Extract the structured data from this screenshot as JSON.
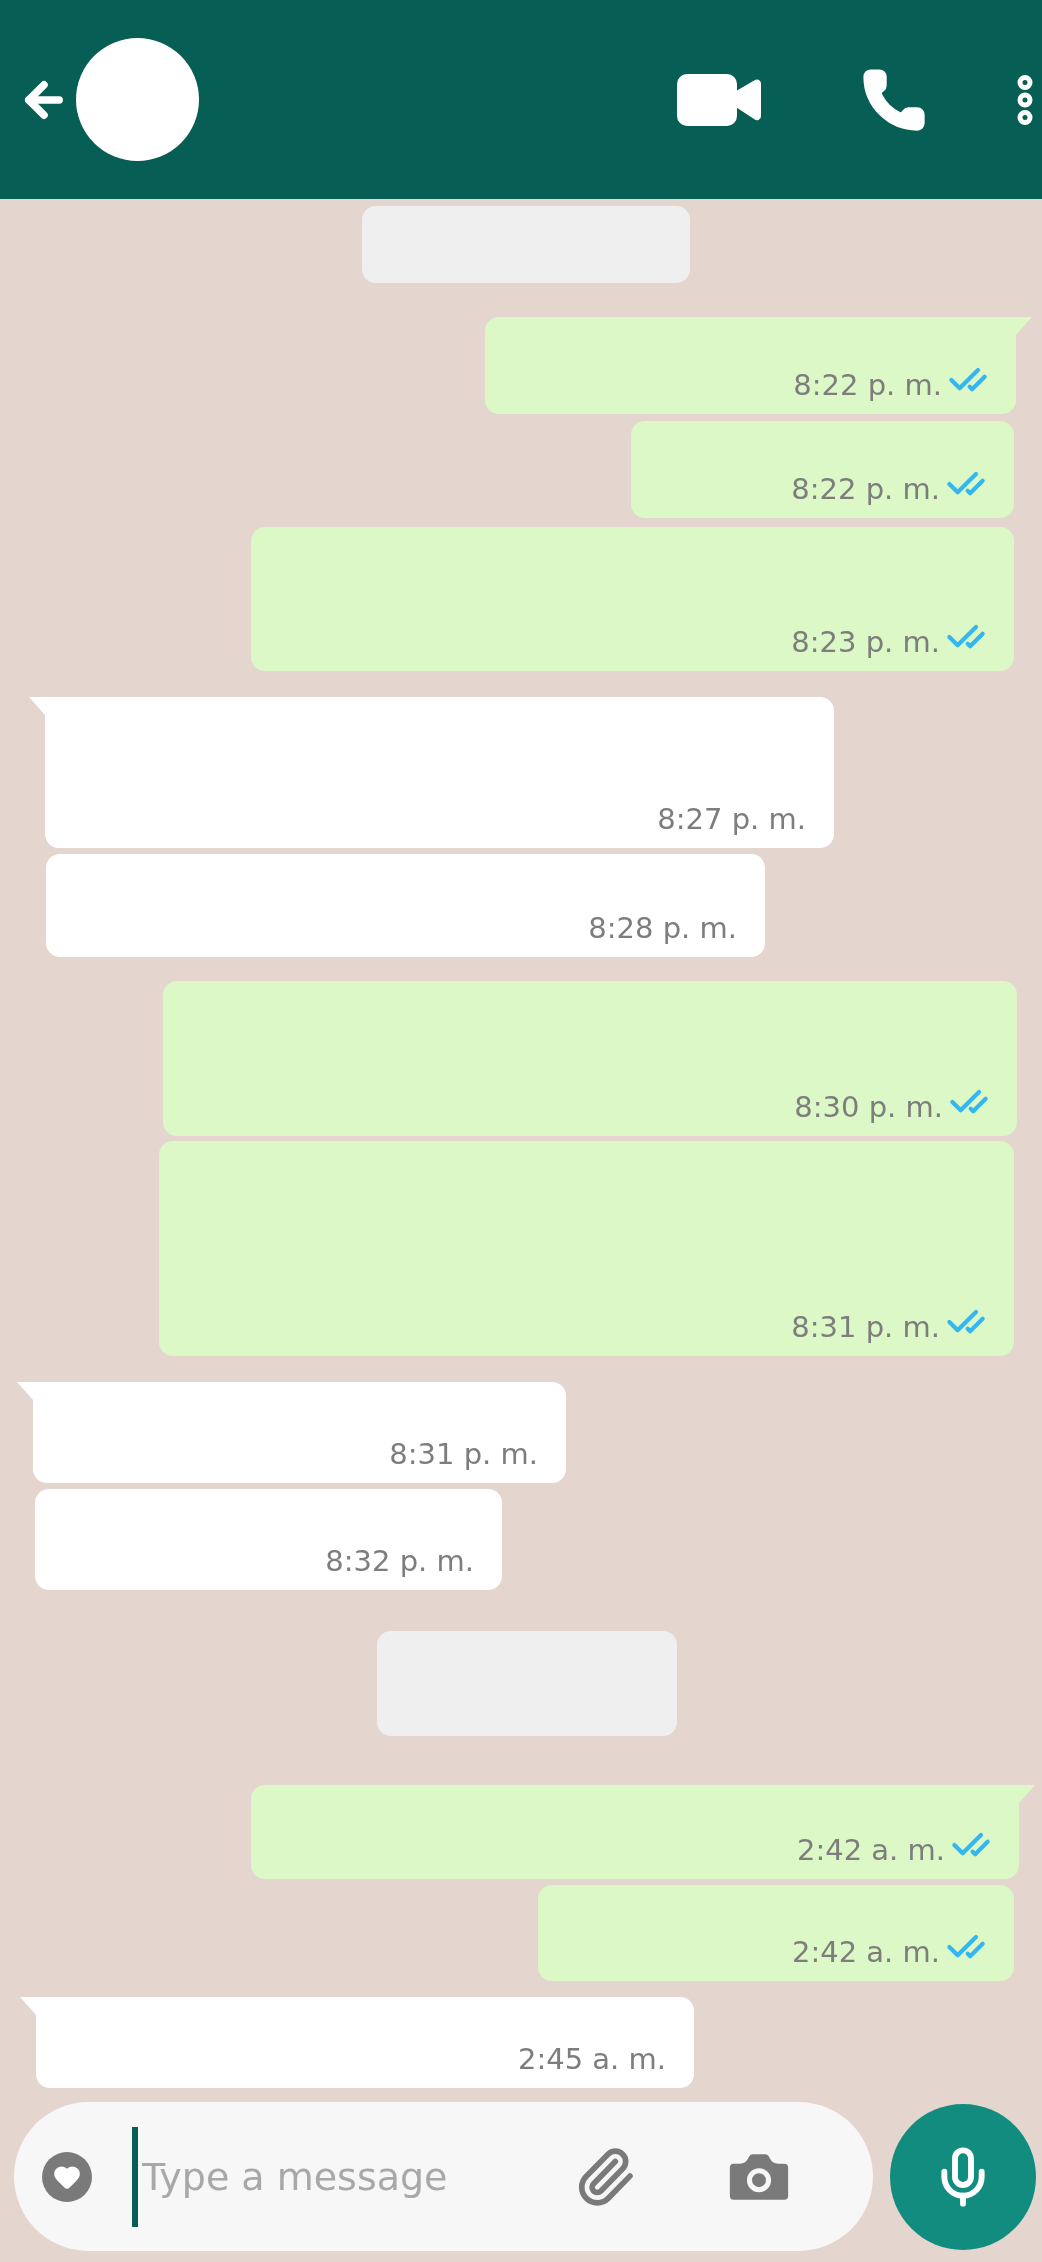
{
  "messages": [
    {
      "kind": "date"
    },
    {
      "kind": "outgoing",
      "time": "8:22 p. m.",
      "read": true,
      "tail": true
    },
    {
      "kind": "outgoing",
      "time": "8:22 p. m.",
      "read": true,
      "tail": false
    },
    {
      "kind": "outgoing",
      "time": "8:23 p. m.",
      "read": true,
      "tail": false
    },
    {
      "kind": "incoming",
      "time": "8:27 p. m.",
      "tail": true
    },
    {
      "kind": "incoming",
      "time": "8:28 p. m.",
      "tail": false
    },
    {
      "kind": "outgoing",
      "time": "8:30 p. m.",
      "read": true,
      "tail": false
    },
    {
      "kind": "outgoing",
      "time": "8:31 p. m.",
      "read": true,
      "tail": false
    },
    {
      "kind": "incoming",
      "time": "8:31 p. m.",
      "tail": true
    },
    {
      "kind": "incoming",
      "time": "8:32 p. m.",
      "tail": false
    },
    {
      "kind": "date"
    },
    {
      "kind": "outgoing",
      "time": "2:42 a. m.",
      "read": true,
      "tail": true
    },
    {
      "kind": "outgoing",
      "time": "2:42 a. m.",
      "read": true,
      "tail": false
    },
    {
      "kind": "incoming",
      "time": "2:45 a. m.",
      "tail": true
    }
  ],
  "composer": {
    "placeholder": "Type a message"
  }
}
